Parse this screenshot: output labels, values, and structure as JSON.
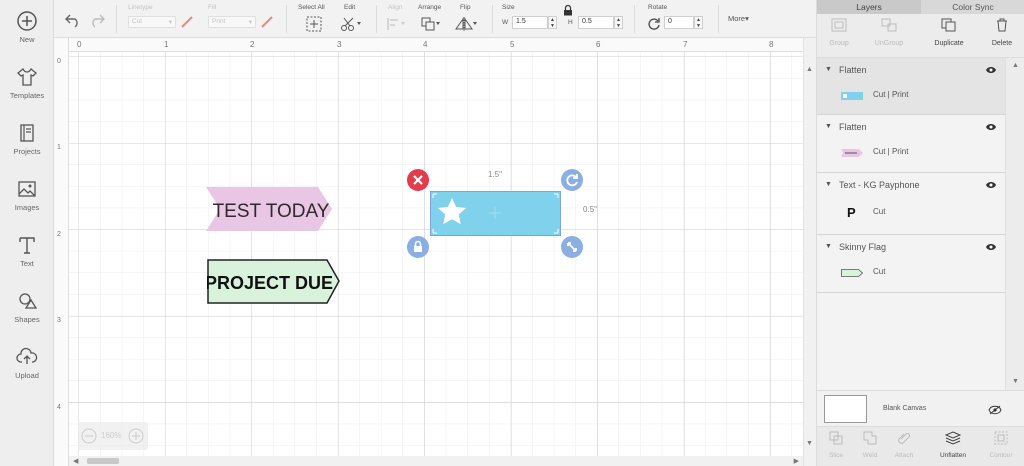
{
  "colors": {
    "accent": "#7fd1ec",
    "handle_blue": "#8aafe0",
    "delete_red": "#e23c4f",
    "flag_pink": "#e8c6e4",
    "flag_green": "#d9f2dc",
    "grid_major": "#cfcfcf",
    "grid_minor": "#ececec"
  },
  "sidebar": {
    "items": [
      {
        "label": "New",
        "icon": "plus-circle-icon"
      },
      {
        "label": "Templates",
        "icon": "shirt-icon"
      },
      {
        "label": "Projects",
        "icon": "book-icon"
      },
      {
        "label": "Images",
        "icon": "image-icon"
      },
      {
        "label": "Text",
        "icon": "text-t-icon"
      },
      {
        "label": "Shapes",
        "icon": "shapes-icon"
      },
      {
        "label": "Upload",
        "icon": "cloud-upload-icon"
      }
    ]
  },
  "toolbar": {
    "linetype_label": "Linetype",
    "linetype_value": "Cut",
    "fill_label": "Fill",
    "fill_value": "Print",
    "select_all_label": "Select All",
    "edit_label": "Edit",
    "align_label": "Align",
    "arrange_label": "Arrange",
    "flip_label": "Flip",
    "size_label": "Size",
    "size_w_label": "W",
    "size_w_value": "1.5",
    "size_h_label": "H",
    "size_h_value": "0.5",
    "rotate_label": "Rotate",
    "rotate_value": "0",
    "more_label": "More▾"
  },
  "canvas": {
    "ruler_top": [
      "0",
      "1",
      "2",
      "3",
      "4",
      "5",
      "6",
      "7",
      "8"
    ],
    "ruler_left": [
      "0",
      "1",
      "2",
      "3",
      "4"
    ],
    "zoom": "160%",
    "objects": {
      "test_today": "TEST TODAY",
      "project_due": "PROJECT DUE",
      "dim_width": "1.5\"",
      "dim_height": "0.5\""
    }
  },
  "panel": {
    "tabs": [
      "Layers",
      "Color Sync"
    ],
    "tools": [
      "Group",
      "UnGroup",
      "Duplicate",
      "Delete"
    ],
    "layers": [
      {
        "title": "Flatten",
        "sub": "Cut  |  Print"
      },
      {
        "title": "Flatten",
        "sub": "Cut  |  Print"
      },
      {
        "title": "Text - KG Payphone",
        "sub": "Cut",
        "glyph": "P"
      },
      {
        "title": "Skinny Flag",
        "sub": "Cut"
      }
    ],
    "blank_canvas": "Blank Canvas",
    "bottom_tools": [
      "Slice",
      "Weld",
      "Attach",
      "Unflatten",
      "Contour"
    ]
  }
}
